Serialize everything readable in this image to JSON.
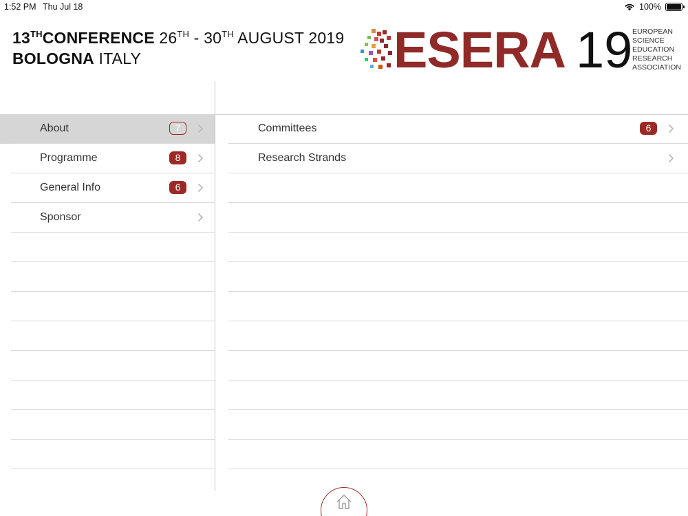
{
  "status_bar": {
    "time": "1:52 PM",
    "date": "Thu Jul 18",
    "battery": "100%"
  },
  "header": {
    "line1": {
      "num": "13",
      "num_sup": "TH",
      "word": "CONFERENCE",
      "start_day": "26",
      "start_sup": "TH",
      "sep": "-",
      "end_day": "30",
      "end_sup": "TH",
      "month_year": "AUGUST 2019"
    },
    "line2": {
      "city": "BOLOGNA",
      "country": "ITALY"
    },
    "logo": {
      "word": "ESERA",
      "year": "19",
      "association": "EUROPEAN\nSCIENCE\nEDUCATION\nRESEARCH\nASSOCIATION",
      "brand_color": "#8f2a28"
    }
  },
  "left_menu": {
    "items": [
      {
        "label": "About",
        "badge": "7",
        "selected": true
      },
      {
        "label": "Programme",
        "badge": "8",
        "selected": false
      },
      {
        "label": "General Info",
        "badge": "6",
        "selected": false
      },
      {
        "label": "Sponsor",
        "badge": "",
        "selected": false
      }
    ]
  },
  "right_menu": {
    "items": [
      {
        "label": "Committees",
        "badge": "6"
      },
      {
        "label": "Research Strands",
        "badge": ""
      }
    ]
  },
  "icons": {
    "chevron": "chevron-right-icon",
    "home": "home-icon",
    "wifi": "wifi-icon",
    "battery": "battery-icon"
  },
  "colors": {
    "accent": "#9b2a27",
    "selected_row": "#d6d6d6"
  }
}
